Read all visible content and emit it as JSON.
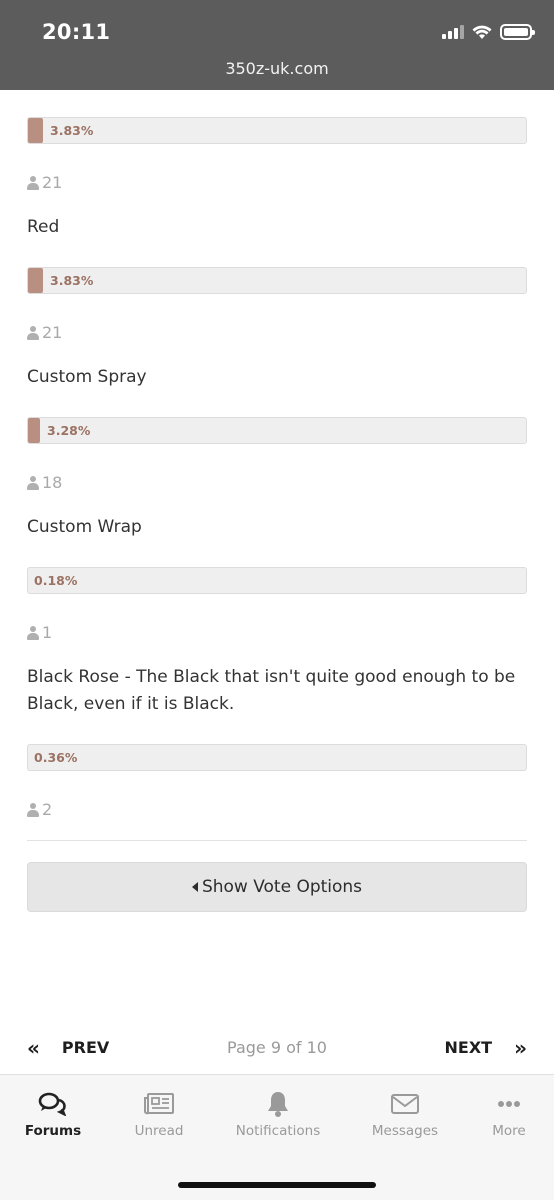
{
  "status_bar": {
    "time": "20:11",
    "url": "350z-uk.com"
  },
  "poll": {
    "items": [
      {
        "label": "",
        "percent": "3.83%",
        "fraction": 0.0383,
        "votes": "21"
      },
      {
        "label": "Red",
        "percent": "3.83%",
        "fraction": 0.0383,
        "votes": "21"
      },
      {
        "label": "Custom Spray",
        "percent": "3.28%",
        "fraction": 0.0328,
        "votes": "18"
      },
      {
        "label": "Custom Wrap",
        "percent": "0.18%",
        "fraction": 0.0018,
        "votes": "1"
      },
      {
        "label": "Black Rose - The Black that isn't quite good enough to be Black, even if it is Black.",
        "percent": "0.36%",
        "fraction": 0.0036,
        "votes": "2"
      }
    ],
    "show_vote_options": "Show Vote Options",
    "bar_color": "#b88f80"
  },
  "pagination": {
    "prev": "PREV",
    "page_info": "Page 9 of 10",
    "next": "NEXT"
  },
  "tabbar": {
    "forums": "Forums",
    "unread": "Unread",
    "notifications": "Notifications",
    "messages": "Messages",
    "more": "More"
  }
}
